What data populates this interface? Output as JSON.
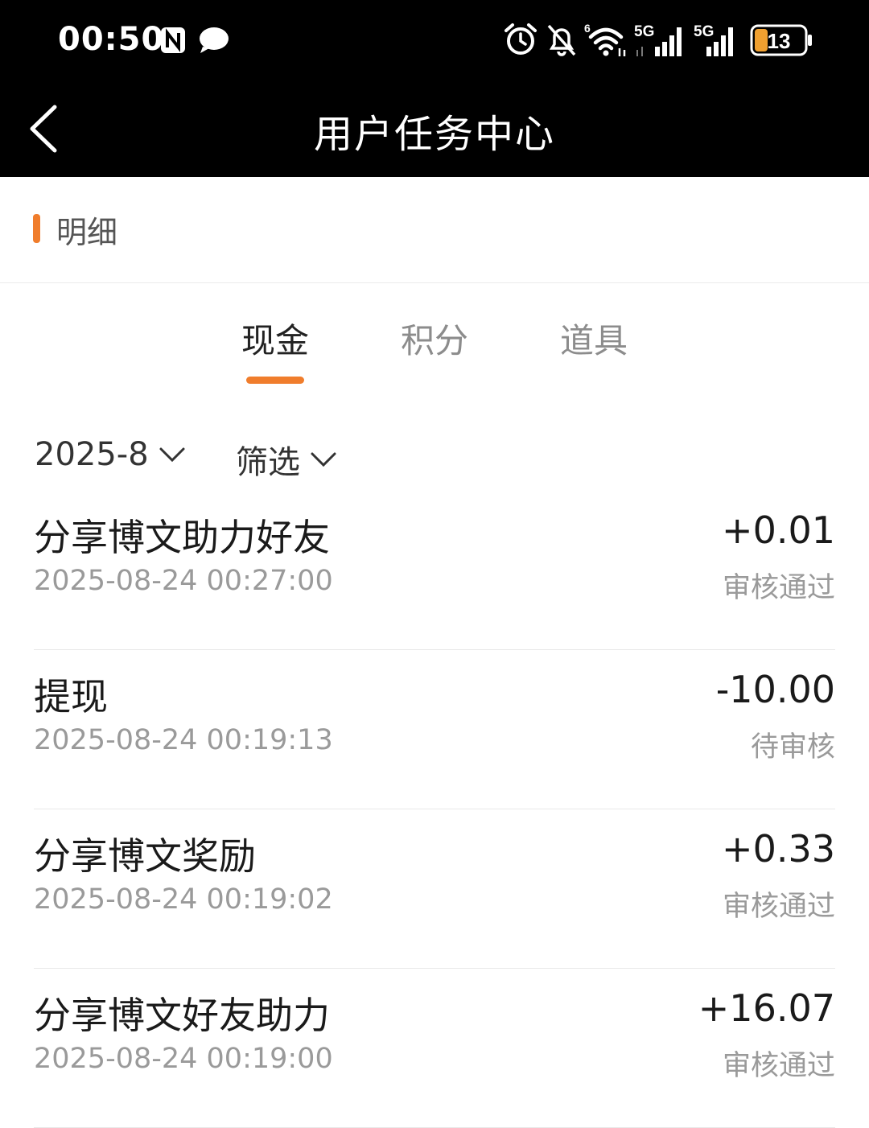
{
  "status_bar": {
    "time": "00:50",
    "network_1": "5G",
    "network_2": "5G",
    "wifi_badge": "6",
    "battery_level": "13",
    "battery_color": "#f0a030",
    "icons": [
      "nfc-icon",
      "message-icon",
      "alarm-icon",
      "mute-bell-icon",
      "wifi-icon",
      "signal-icon",
      "signal-icon",
      "battery-icon"
    ]
  },
  "header": {
    "title": "用户任务中心",
    "back_icon": "chevron-left-icon"
  },
  "section": {
    "label": "明细",
    "accent_color": "#f07d2c"
  },
  "tabs": [
    {
      "label": "现金",
      "active": true
    },
    {
      "label": "积分",
      "active": false
    },
    {
      "label": "道具",
      "active": false
    }
  ],
  "filters": {
    "month": "2025-8",
    "filter_label": "筛选"
  },
  "records": [
    {
      "title": "分享博文助力好友",
      "time": "2025-08-24 00:27:00",
      "amount": "+0.01",
      "status": "审核通过"
    },
    {
      "title": "提现",
      "time": "2025-08-24 00:19:13",
      "amount": "-10.00",
      "status": "待审核"
    },
    {
      "title": "分享博文奖励",
      "time": "2025-08-24 00:19:02",
      "amount": "+0.33",
      "status": "审核通过"
    },
    {
      "title": "分享博文好友助力",
      "time": "2025-08-24 00:19:00",
      "amount": "+16.07",
      "status": "审核通过"
    }
  ]
}
